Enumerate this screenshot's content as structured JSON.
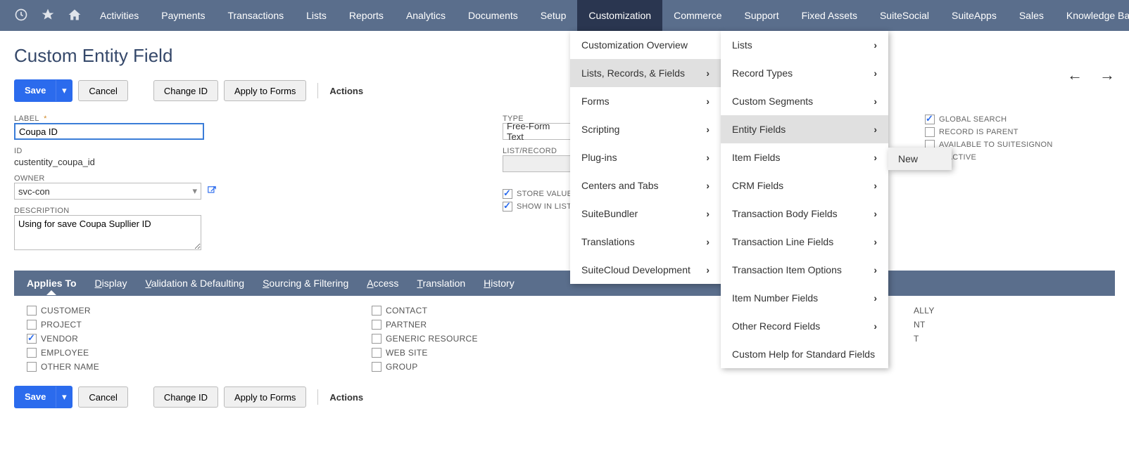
{
  "nav": {
    "items": [
      "Activities",
      "Payments",
      "Transactions",
      "Lists",
      "Reports",
      "Analytics",
      "Documents",
      "Setup",
      "Customization",
      "Commerce",
      "Support",
      "Fixed Assets",
      "SuiteSocial",
      "SuiteApps",
      "Sales",
      "Knowledge Base"
    ],
    "activeIndex": 8
  },
  "dropdown": {
    "items": [
      {
        "label": "Customization Overview",
        "hasSub": false
      },
      {
        "label": "Lists, Records, & Fields",
        "hasSub": true,
        "hover": true
      },
      {
        "label": "Forms",
        "hasSub": true
      },
      {
        "label": "Scripting",
        "hasSub": true
      },
      {
        "label": "Plug-ins",
        "hasSub": true
      },
      {
        "label": "Centers and Tabs",
        "hasSub": true
      },
      {
        "label": "SuiteBundler",
        "hasSub": true
      },
      {
        "label": "Translations",
        "hasSub": true
      },
      {
        "label": "SuiteCloud Development",
        "hasSub": true
      }
    ]
  },
  "submenu": {
    "items": [
      {
        "label": "Lists",
        "hasSub": true
      },
      {
        "label": "Record Types",
        "hasSub": true
      },
      {
        "label": "Custom Segments",
        "hasSub": true
      },
      {
        "label": "Entity Fields",
        "hasSub": true,
        "hover": true
      },
      {
        "label": "Item Fields",
        "hasSub": true
      },
      {
        "label": "CRM Fields",
        "hasSub": true
      },
      {
        "label": "Transaction Body Fields",
        "hasSub": true
      },
      {
        "label": "Transaction Line Fields",
        "hasSub": true
      },
      {
        "label": "Transaction Item Options",
        "hasSub": true
      },
      {
        "label": "Item Number Fields",
        "hasSub": true
      },
      {
        "label": "Other Record Fields",
        "hasSub": true
      },
      {
        "label": "Custom Help for Standard Fields",
        "hasSub": false
      }
    ]
  },
  "submenu3": {
    "label": "New"
  },
  "page": {
    "title": "Custom Entity Field",
    "save": "Save",
    "cancel": "Cancel",
    "changeId": "Change ID",
    "applyForms": "Apply to Forms",
    "actions": "Actions"
  },
  "fields": {
    "label": {
      "title": "LABEL",
      "value": "Coupa ID"
    },
    "id": {
      "title": "ID",
      "value": "custentity_coupa_id"
    },
    "owner": {
      "title": "OWNER",
      "value": "svc-con"
    },
    "description": {
      "title": "DESCRIPTION",
      "value": "Using for save Coupa Supllier ID"
    },
    "type": {
      "title": "TYPE",
      "value": "Free-Form Text"
    },
    "listRecord": {
      "title": "LIST/RECORD"
    },
    "storeValue": {
      "label": "STORE VALUE",
      "checked": true
    },
    "showInList": {
      "label": "SHOW IN LIST",
      "checked": true
    },
    "globalSearch": {
      "label": "GLOBAL SEARCH",
      "checked": true
    },
    "recordIsParent": {
      "label": "RECORD IS PARENT",
      "checked": false
    },
    "availableSign": {
      "label": "AVAILABLE TO SUITESIGNON",
      "checked": false
    },
    "inactive": {
      "label": "INACTIVE",
      "checked": false
    }
  },
  "tabs": [
    "Applies To",
    "Display",
    "Validation & Defaulting",
    "Sourcing & Filtering",
    "Access",
    "Translation",
    "History"
  ],
  "applies": {
    "col1": [
      {
        "label": "CUSTOMER",
        "checked": false
      },
      {
        "label": "PROJECT",
        "checked": false
      },
      {
        "label": "VENDOR",
        "checked": true
      },
      {
        "label": "EMPLOYEE",
        "checked": false
      },
      {
        "label": "OTHER NAME",
        "checked": false
      }
    ],
    "col2": [
      {
        "label": "CONTACT",
        "checked": false
      },
      {
        "label": "PARTNER",
        "checked": false
      },
      {
        "label": "GENERIC RESOURCE",
        "checked": false
      },
      {
        "label": "WEB SITE",
        "checked": false
      },
      {
        "label": "GROUP",
        "checked": false
      }
    ],
    "col3": [
      {
        "label": "ALLY"
      },
      {
        "label": "NT"
      },
      {
        "label": "T"
      }
    ]
  }
}
